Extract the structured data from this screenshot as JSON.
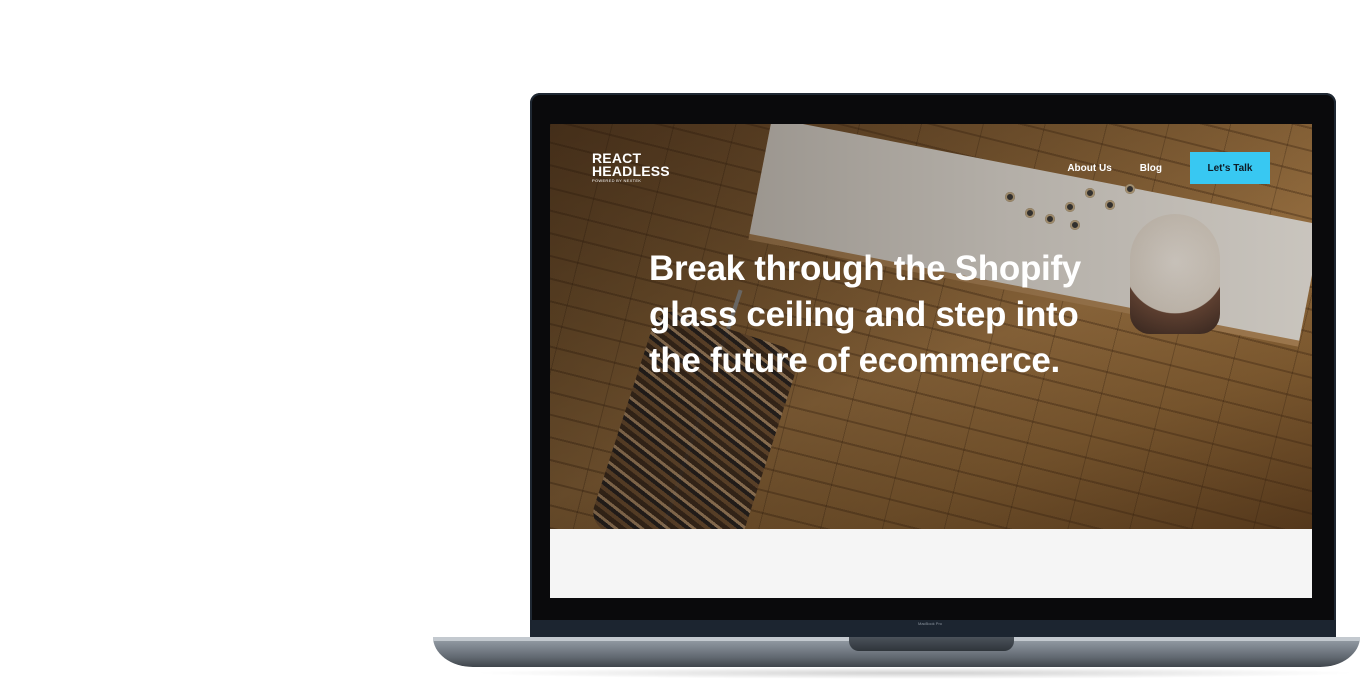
{
  "site": {
    "logo_line1": "REACT",
    "logo_line2": "HEADLESS",
    "logo_sub": "POWERED BY NEXTEK"
  },
  "nav": {
    "about_label": "About Us",
    "blog_label": "Blog",
    "cta_label": "Let's Talk",
    "cta_color": "#38c8f2"
  },
  "hero": {
    "headline": "Break through the Shopify glass ceiling and step into the future of ecommerce."
  },
  "device": {
    "brand_label": "MacBook Pro"
  }
}
